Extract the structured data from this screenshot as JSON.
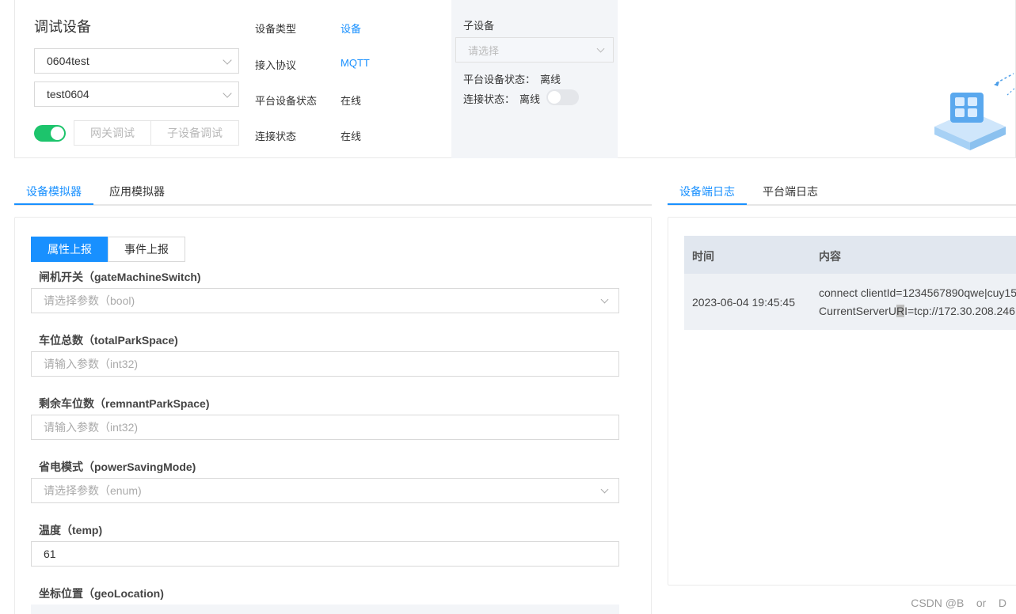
{
  "header": {
    "title": "调试设备",
    "device_select": "0604test",
    "product_select": "test0604",
    "gateway_debug_btn": "网关调试",
    "subdevice_debug_btn": "子设备调试",
    "info": {
      "device_type_label": "设备类型",
      "device_type_value": "设备",
      "protocol_label": "接入协议",
      "protocol_value": "MQTT",
      "platform_status_label": "平台设备状态",
      "platform_status_value": "在线",
      "connect_status_label": "连接状态",
      "connect_status_value": "在线"
    },
    "subdevice": {
      "label": "子设备",
      "placeholder": "请选择",
      "platform_status": "平台设备状态：",
      "platform_status_value": "离线",
      "connect_status": "连接状态：",
      "connect_status_value": "离线"
    }
  },
  "left_tabs": [
    "设备模拟器",
    "应用模拟器"
  ],
  "right_tabs": [
    "设备端日志",
    "平台端日志"
  ],
  "segment": [
    "属性上报",
    "事件上报"
  ],
  "fields": [
    {
      "label": "闸机开关（gateMachineSwitch)",
      "placeholder": "请选择参数（bool)",
      "value": "",
      "type": "select"
    },
    {
      "label": "车位总数（totalParkSpace)",
      "placeholder": "请输入参数（int32)",
      "value": "",
      "type": "input"
    },
    {
      "label": "剩余车位数（remnantParkSpace)",
      "placeholder": "请输入参数（int32)",
      "value": "",
      "type": "input"
    },
    {
      "label": "省电模式（powerSavingMode)",
      "placeholder": "请选择参数（enum)",
      "value": "",
      "type": "select"
    },
    {
      "label": "温度（temp)",
      "placeholder": "",
      "value": "61",
      "type": "input"
    },
    {
      "label": "坐标位置（geoLocation)",
      "placeholder": "",
      "value": "",
      "type": "input"
    }
  ],
  "log_table": {
    "columns": [
      "时间",
      "内容"
    ],
    "rows": [
      {
        "time": "2023-06-04 19:45:45",
        "content_line1": "connect clientId=1234567890qwe|cuy15",
        "content_line2_a": "CurrentServerU",
        "content_line2_hl": "R",
        "content_line2_b": "I=tcp://172.30.208.246"
      }
    ]
  },
  "watermark": "CSDN @B    or    D",
  "colors": {
    "accent": "#1890ff",
    "switch_on": "#1dc46c"
  }
}
